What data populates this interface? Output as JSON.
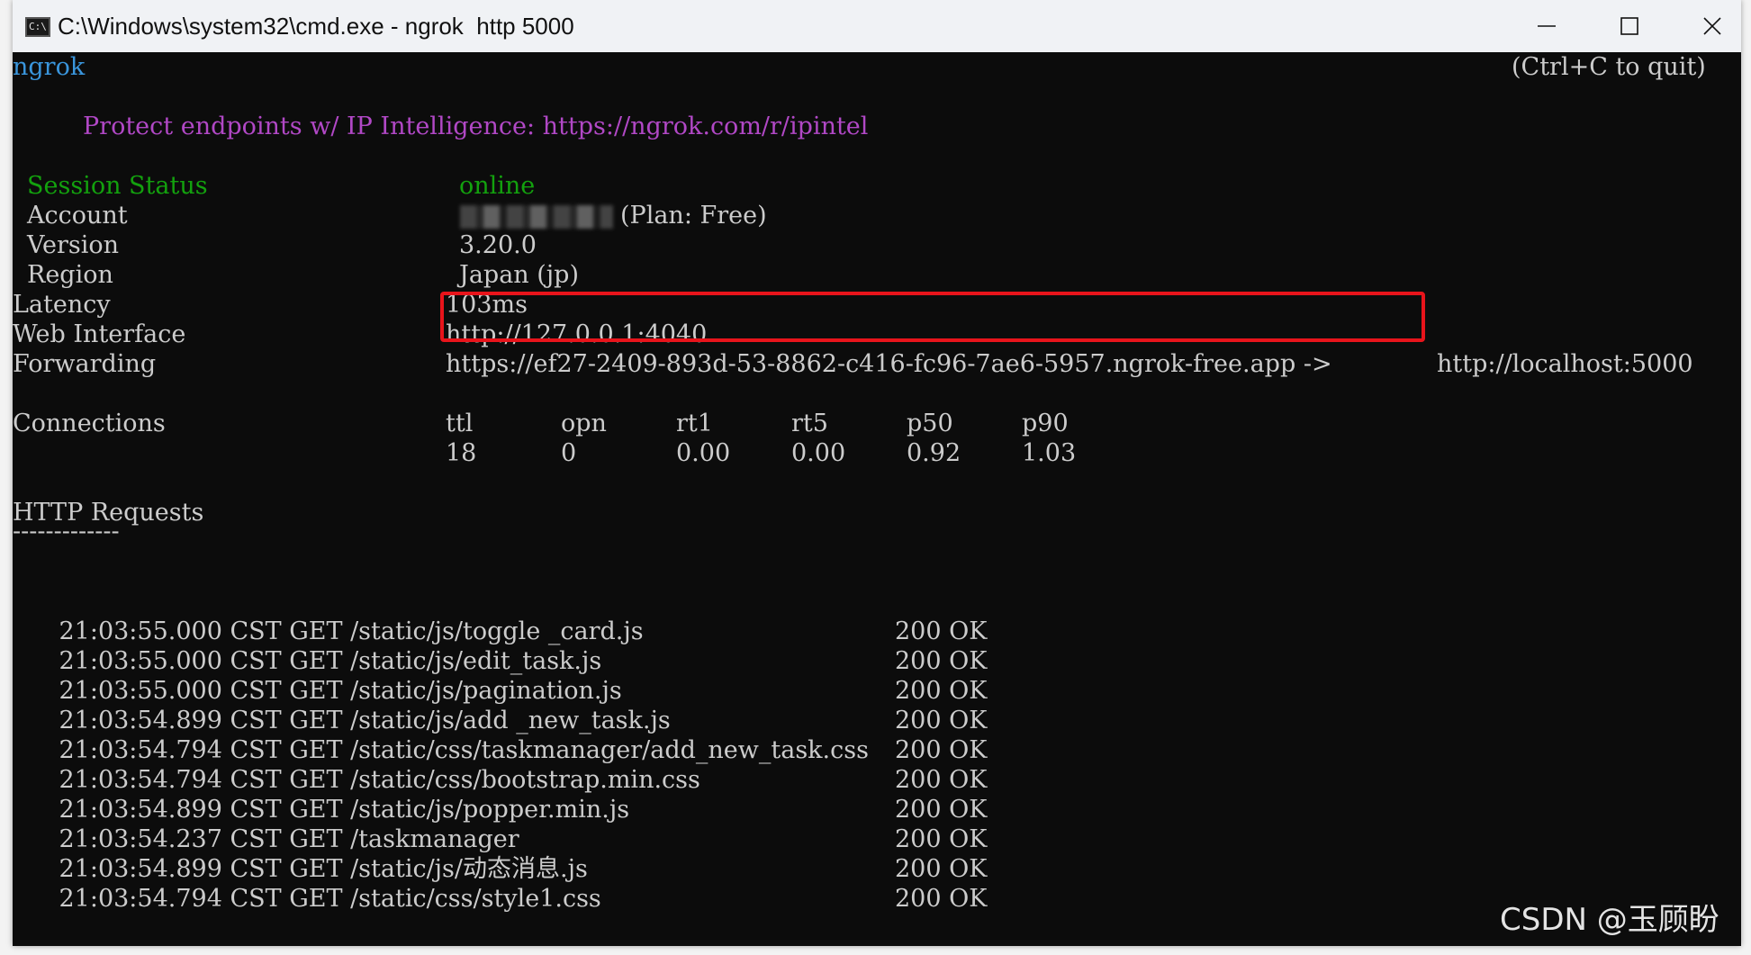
{
  "window": {
    "title": "C:\\Windows\\system32\\cmd.exe - ngrok  http 5000",
    "icon": "cmd-icon"
  },
  "terminal": {
    "app_name": "ngrok",
    "quit_hint": "(Ctrl+C to quit)",
    "promo": "Protect endpoints w/ IP Intelligence: https://ngrok.com/r/ipintel",
    "session_status_label": "Session Status",
    "session_status_value": "online",
    "account_label": "Account",
    "account_plan": "(Plan: Free)",
    "version_label": "Version",
    "version_value": "3.20.0",
    "region_label": "Region",
    "region_value": "Japan (jp)",
    "latency_label": "Latency",
    "latency_value": "103ms",
    "web_interface_label": "Web Interface",
    "web_interface_value": "http://127.0.0.1:4040",
    "forwarding_label": "Forwarding",
    "forwarding_public": "https://ef27-2409-893d-53-8862-c416-fc96-7ae6-5957.ngrok-free.app ->",
    "forwarding_local": "http://localhost:5000",
    "connections_label": "Connections",
    "connections_headers": [
      "ttl",
      "opn",
      "rt1",
      "rt5",
      "p50",
      "p90"
    ],
    "connections_values": [
      "18",
      "0",
      "0.00",
      "0.00",
      "0.92",
      "1.03"
    ],
    "http_requests_label": "HTTP Requests",
    "http_requests_rule": "-------------",
    "requests": [
      {
        "entry": "21:03:55.000 CST GET /static/js/toggle _card.js",
        "status": "200 OK"
      },
      {
        "entry": "21:03:55.000 CST GET /static/js/edit_task.js",
        "status": "200 OK"
      },
      {
        "entry": "21:03:55.000 CST GET /static/js/pagination.js",
        "status": "200 OK"
      },
      {
        "entry": "21:03:54.899 CST GET /static/js/add _new_task.js",
        "status": "200 OK"
      },
      {
        "entry": "21:03:54.794 CST GET /static/css/taskmanager/add_new_task.css",
        "status": "200 OK"
      },
      {
        "entry": "21:03:54.794 CST GET /static/css/bootstrap.min.css",
        "status": "200 OK"
      },
      {
        "entry": "21:03:54.899 CST GET /static/js/popper.min.js",
        "status": "200 OK"
      },
      {
        "entry": "21:03:54.237 CST GET /taskmanager",
        "status": "200 OK"
      },
      {
        "entry": "21:03:54.899 CST GET /static/js/动态消息.js",
        "status": "200 OK"
      },
      {
        "entry": "21:03:54.794 CST GET /static/css/style1.css",
        "status": "200 OK"
      }
    ]
  },
  "watermark": "CSDN @玉顾盼",
  "colors": {
    "background": "#0c0c0c",
    "text": "#cccccc",
    "promo": "#b148c6",
    "status_online": "#13a10e",
    "highlight_box": "#e8141b"
  }
}
